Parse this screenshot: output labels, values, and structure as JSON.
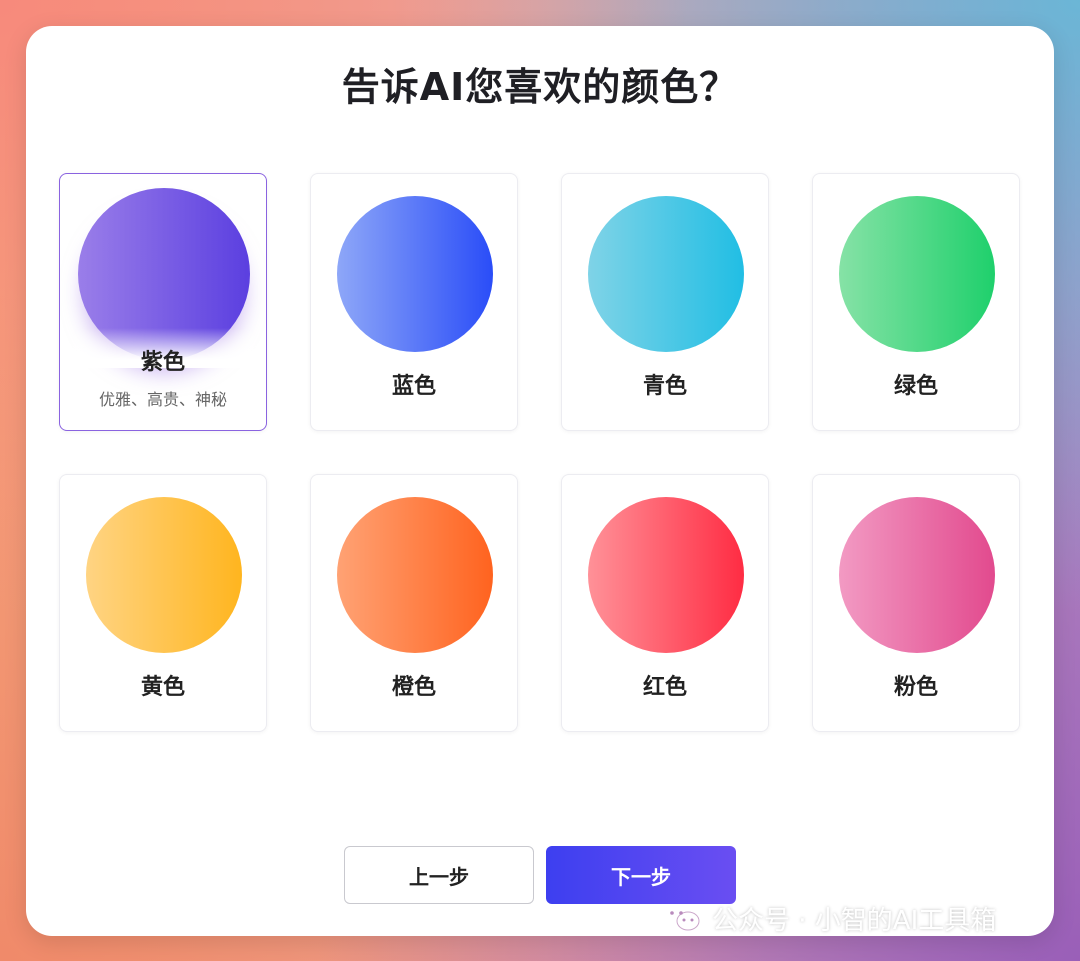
{
  "dialog": {
    "title": "告诉AI您喜欢的颜色？"
  },
  "colors": [
    {
      "label": "紫色",
      "description": "优雅、高贵、神秘",
      "selected": true,
      "from": "#9a7ee9",
      "to": "#5b3fe0"
    },
    {
      "label": "蓝色",
      "selected": false,
      "from": "#8ea7f8",
      "to": "#2a4df8"
    },
    {
      "label": "青色",
      "selected": false,
      "from": "#7fd3e7",
      "to": "#21bee4"
    },
    {
      "label": "绿色",
      "selected": false,
      "from": "#86e2a6",
      "to": "#1fd06c"
    },
    {
      "label": "黄色",
      "selected": false,
      "from": "#ffd483",
      "to": "#ffb51f"
    },
    {
      "label": "橙色",
      "selected": false,
      "from": "#ffa274",
      "to": "#ff631f"
    },
    {
      "label": "红色",
      "selected": false,
      "from": "#ff9198",
      "to": "#ff2c43"
    },
    {
      "label": "粉色",
      "selected": false,
      "from": "#f29ac3",
      "to": "#e24a8e"
    }
  ],
  "buttons": {
    "prev_label": "上一步",
    "next_label": "下一步"
  },
  "watermark": {
    "text": "公众号 · 小智的AI工具箱",
    "icon": "wechat-icon"
  }
}
